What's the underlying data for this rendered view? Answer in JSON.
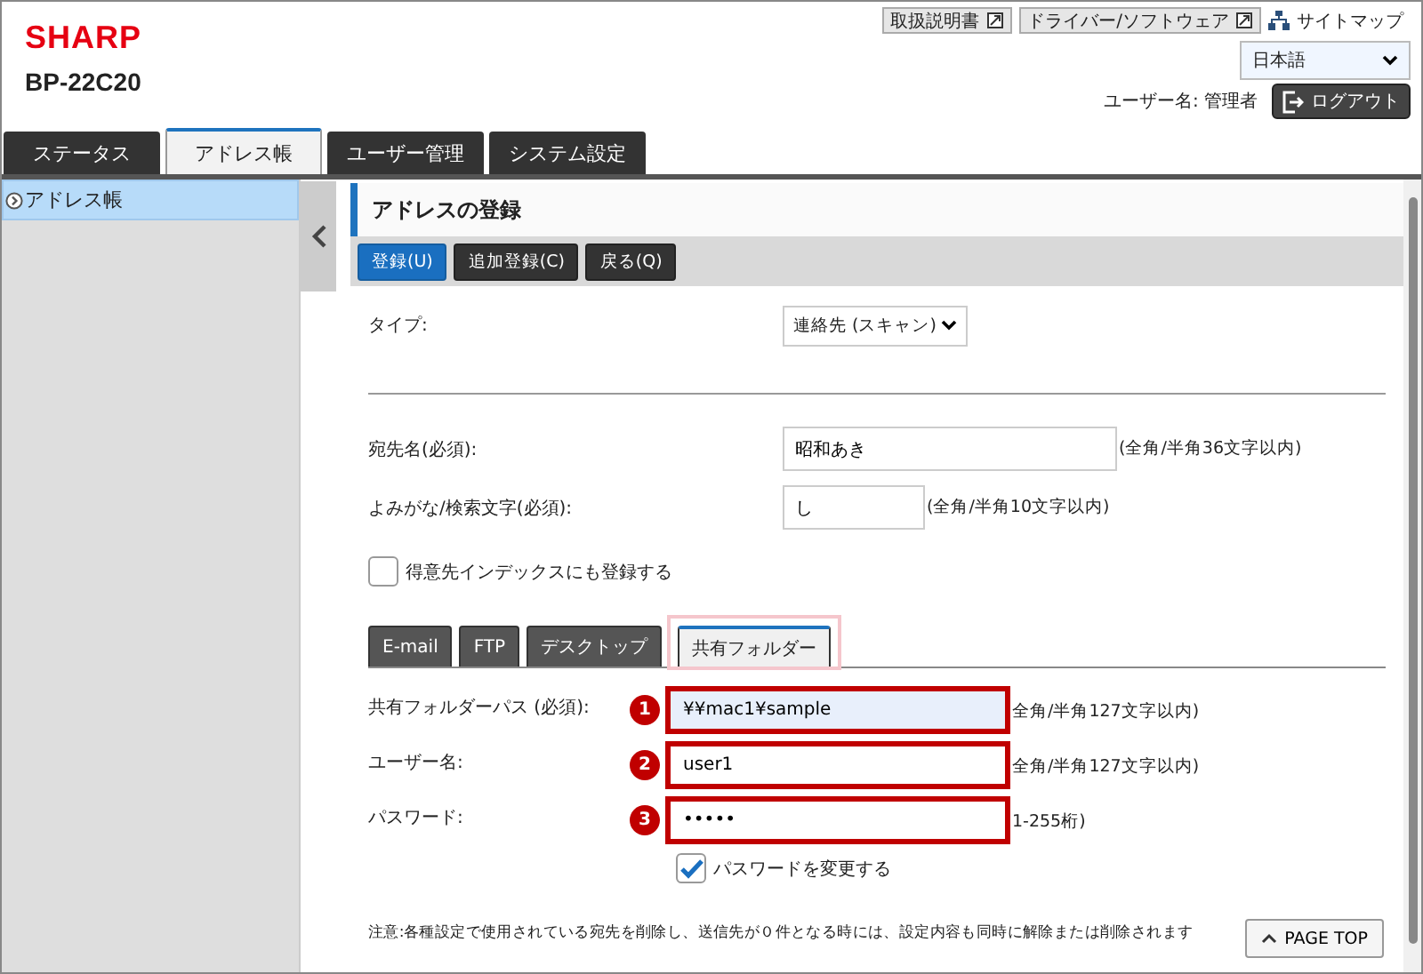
{
  "header": {
    "logo": "SHARP",
    "model": "BP-22C20",
    "links": [
      {
        "label": "取扱説明書",
        "kind": "doc"
      },
      {
        "label": "ドライバー/ソフトウェア",
        "kind": "doc"
      },
      {
        "label": "サイトマップ",
        "kind": "sitemap"
      }
    ],
    "language": "日本語",
    "user": "ユーザー名: 管理者",
    "logout": "ログアウト"
  },
  "tabs": [
    {
      "label": "ステータス",
      "selected": false
    },
    {
      "label": "アドレス帳",
      "selected": true
    },
    {
      "label": "ユーザー管理",
      "selected": false
    },
    {
      "label": "システム設定",
      "selected": false
    }
  ],
  "sidebar": {
    "items": [
      {
        "label": "アドレス帳",
        "selected": true
      }
    ]
  },
  "page": {
    "title": "アドレスの登録",
    "buttons": [
      {
        "label": "登録(U)",
        "primary": true
      },
      {
        "label": "追加登録(C)",
        "primary": false
      },
      {
        "label": "戻る(Q)",
        "primary": false
      }
    ],
    "type_row": {
      "label": "タイプ:",
      "value": "連絡先 (スキャン)"
    },
    "fields": [
      {
        "label": "宛先名(必須):",
        "value": "昭和あき",
        "hint": "(全角/半角36文字以内)",
        "kind": "wide"
      },
      {
        "label": "よみがな/検索文字(必須):",
        "value": "し",
        "hint": "(全角/半角10文字以内)",
        "kind": "short"
      }
    ],
    "index_checkbox": {
      "label": "得意先インデックスにも登録する",
      "checked": false
    },
    "subtabs": [
      {
        "label": "E-mail",
        "selected": false,
        "highlighted": false
      },
      {
        "label": "FTP",
        "selected": false,
        "highlighted": false
      },
      {
        "label": "デスクトップ",
        "selected": false,
        "highlighted": false
      },
      {
        "label": "共有フォルダー",
        "selected": true,
        "highlighted": true
      }
    ],
    "folder_fields": [
      {
        "label": "共有フォルダーパス (必須):",
        "value": "¥¥mac1¥sample",
        "hint": "全角/半角127文字以内)",
        "callout": "1",
        "focused": true
      },
      {
        "label": "ユーザー名:",
        "value": "user1",
        "hint": "全角/半角127文字以内)",
        "callout": "2",
        "focused": false
      },
      {
        "label": "パスワード:",
        "value": "•••••",
        "hint": "1-255桁)",
        "callout": "3",
        "focused": false
      }
    ],
    "password_checkbox": {
      "label": "パスワードを変更する",
      "checked": true
    },
    "note": "注意:各種設定で使用されている宛先を削除し、送信先が０件となる時には、設定内容も同時に解除または削除されます",
    "page_top": "PAGE TOP"
  }
}
